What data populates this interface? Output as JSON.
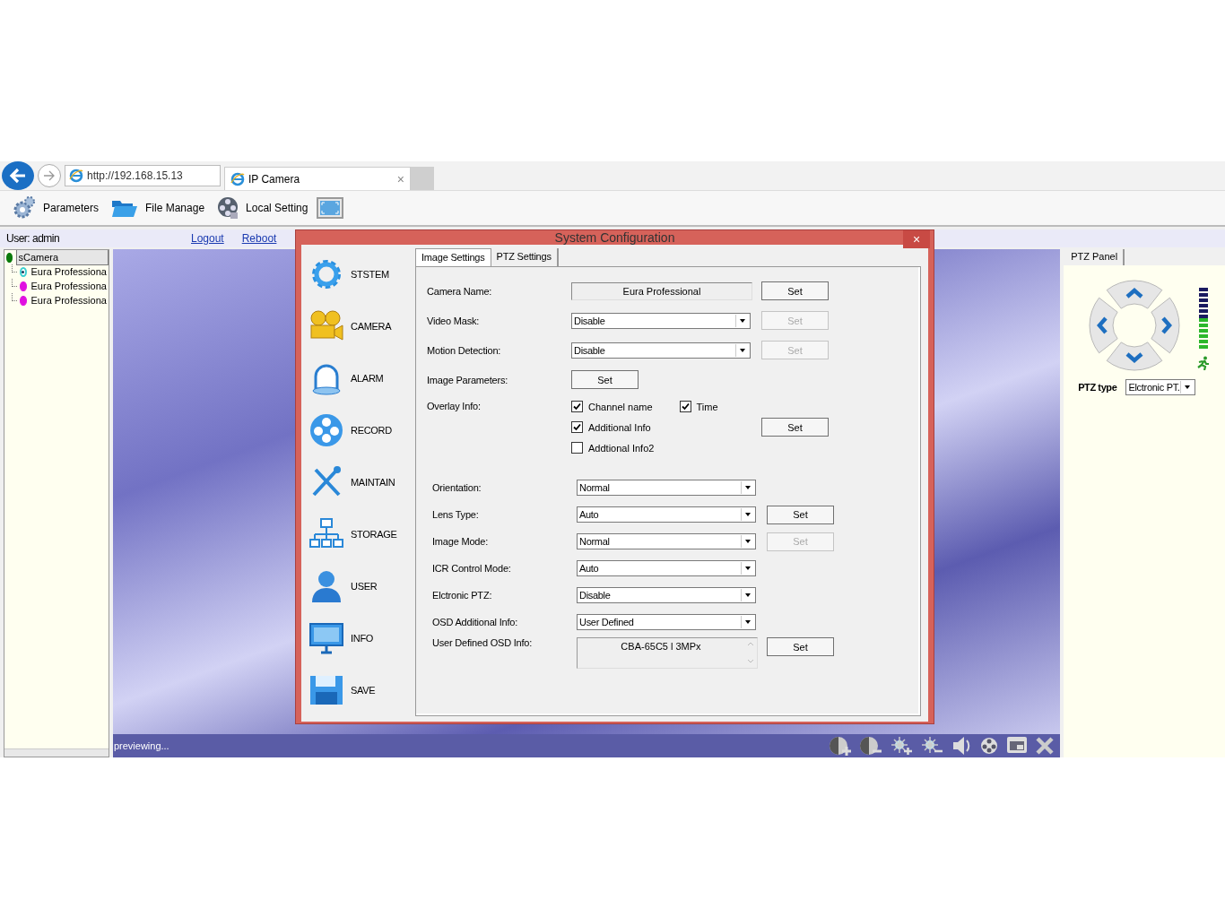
{
  "browser": {
    "address": "http://192.168.15.13",
    "tab": {
      "title": "IP Camera",
      "close": "×"
    }
  },
  "toolbar": [
    {
      "label": "Parameters"
    },
    {
      "label": "File Manage"
    },
    {
      "label": "Local Setting"
    }
  ],
  "user_bar": {
    "user": "User: admin",
    "links": [
      "Logout",
      "Reboot"
    ]
  },
  "device_tree": {
    "label": "sCamera",
    "color": "#0b7a0b",
    "kind": "dot",
    "selected": true,
    "children": [
      {
        "label": "Eura Professiona",
        "color": "#3ccfd0",
        "kind": "ring",
        "selected": false
      },
      {
        "label": "Eura Professiona",
        "color": "#e010e0",
        "kind": "dot",
        "selected": false
      },
      {
        "label": "Eura Professiona",
        "color": "#e010e0",
        "kind": "dot",
        "selected": false
      }
    ]
  },
  "preview": {
    "status": "previewing..."
  },
  "ptz_panel": {
    "tab": "PTZ Panel",
    "speed": {
      "level": 0.5
    },
    "type_label": "PTZ type",
    "type_value": "Elctronic PT."
  },
  "dialog": {
    "title": "System Configuration",
    "close": "×",
    "menu": [
      "STSTEM",
      "CAMERA",
      "ALARM",
      "RECORD",
      "MAINTAIN",
      "STORAGE",
      "USER",
      "INFO",
      "SAVE"
    ],
    "tabs": [
      {
        "label": "Image Settings",
        "selected": true
      },
      {
        "label": "PTZ Settings",
        "selected": false
      }
    ],
    "sections": [
      [
        {
          "label": "Camera Name:",
          "kind": "text",
          "value": "Eura Professional",
          "set": {
            "label": "Set",
            "disabled": false
          }
        },
        {
          "label": "Video Mask:",
          "kind": "select",
          "value": "Disable",
          "set": {
            "label": "Set",
            "disabled": true
          }
        },
        {
          "label": "Motion Detection:",
          "kind": "select",
          "value": "Disable",
          "set": {
            "label": "Set",
            "disabled": true
          }
        },
        {
          "label": "Image Parameters:",
          "kind": "button",
          "set": {
            "label": "Set",
            "disabled": false
          }
        },
        {
          "label": "Overlay Info:",
          "kind": "checks",
          "lines": [
            [
              {
                "label": "Channel name",
                "checked": true
              },
              {
                "label": "Time",
                "checked": true
              }
            ],
            [
              {
                "label": "Additional Info",
                "checked": true
              }
            ],
            [
              {
                "label": "Addtional Info2",
                "checked": false
              }
            ]
          ],
          "set": {
            "label": "Set",
            "disabled": false
          }
        }
      ],
      [
        {
          "label": "Orientation:",
          "kind": "select",
          "value": "Normal"
        },
        {
          "label": "Lens Type:",
          "kind": "select",
          "value": "Auto",
          "set": {
            "label": "Set",
            "disabled": false
          }
        },
        {
          "label": "Image Mode:",
          "kind": "select",
          "value": "Normal",
          "set": {
            "label": "Set",
            "disabled": true
          }
        },
        {
          "label": "ICR Control Mode:",
          "kind": "select",
          "value": "Auto"
        },
        {
          "label": "Elctronic PTZ:",
          "kind": "select",
          "value": "Disable"
        },
        {
          "label": "OSD Additional Info:",
          "kind": "select",
          "value": "User Defined"
        },
        {
          "label": "User Defined OSD Info:",
          "kind": "textarea",
          "value": "CBA-65C5 l 3MPx",
          "set": {
            "label": "Set",
            "disabled": false
          }
        }
      ]
    ]
  }
}
